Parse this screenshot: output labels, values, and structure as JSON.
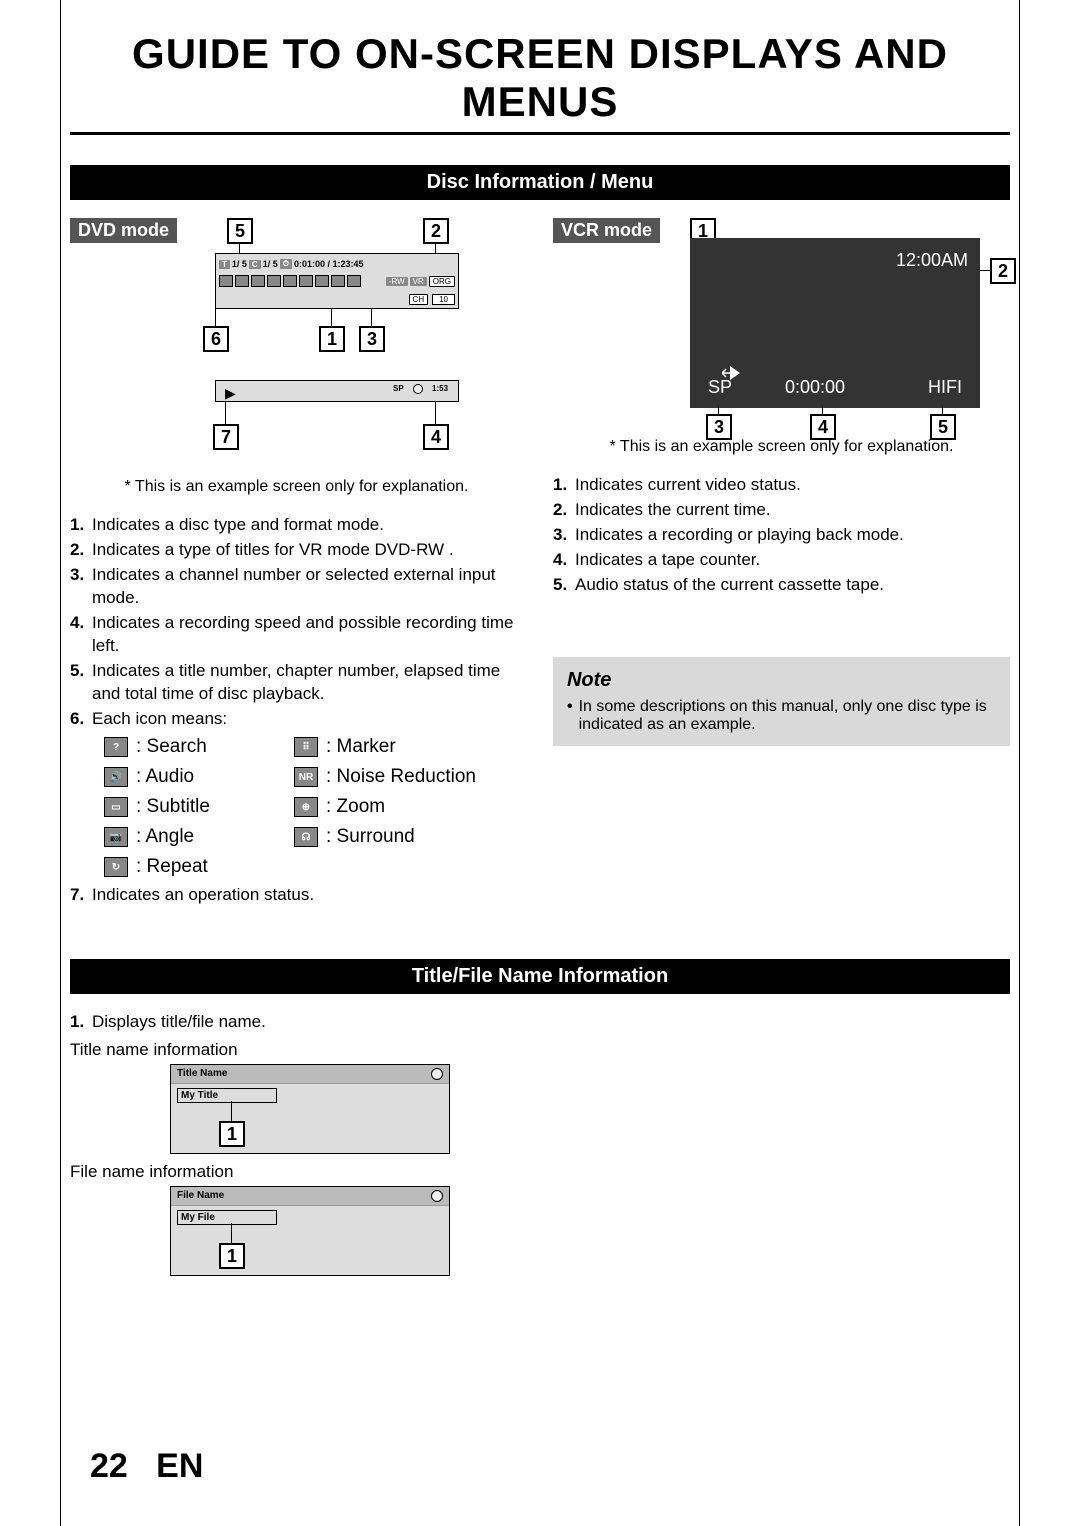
{
  "page": {
    "title": "GUIDE TO ON-SCREEN DISPLAYS AND MENUS",
    "number": "22",
    "lang": "EN"
  },
  "sections": {
    "disc_info": "Disc Information / Menu",
    "title_file": "Title/File Name Information"
  },
  "modes": {
    "dvd": "DVD mode",
    "vcr": "VCR mode"
  },
  "dvd_osd": {
    "t": "T",
    "t_val": "1/   5",
    "c": "C",
    "c_val": "1/   5",
    "time": "0:01:00 / 1:23:45",
    "rw": "-RW",
    "vr": "VR",
    "org": "ORG",
    "ch": "CH",
    "ch_val": "10",
    "sp": "SP",
    "rec_time": "1:53"
  },
  "vcr_osd": {
    "time": "12:00AM",
    "sp": "SP",
    "counter": "0:00:00",
    "hifi": "HIFI"
  },
  "footnote": "* This is an example screen only for explanation.",
  "dvd_list": [
    "Indicates a disc type and format mode.",
    "Indicates a type of titles for VR mode DVD-RW .",
    "Indicates a channel number or selected external input mode.",
    "Indicates a recording speed and possible recording time left.",
    "Indicates a title number, chapter number, elapsed time and total time of disc playback.",
    "Each icon means:",
    "Indicates an operation status."
  ],
  "icon_legend": [
    {
      "sym": "?",
      "label": ": Search"
    },
    {
      "sym": "M",
      "label": ": Marker"
    },
    {
      "sym": "♪",
      "label": ": Audio"
    },
    {
      "sym": "NR",
      "label": ": Noise Reduction"
    },
    {
      "sym": "□",
      "label": ": Subtitle"
    },
    {
      "sym": "⊕",
      "label": ": Zoom"
    },
    {
      "sym": "A",
      "label": ": Angle"
    },
    {
      "sym": "S",
      "label": ": Surround"
    },
    {
      "sym": "↻",
      "label": ": Repeat"
    }
  ],
  "vcr_list": [
    "Indicates current video status.",
    "Indicates the current time.",
    "Indicates a recording or playing back mode.",
    "Indicates a tape counter.",
    "Audio status of the current cassette tape."
  ],
  "note": {
    "heading": "Note",
    "text": "In some descriptions on this manual, only one disc type is indicated as an example."
  },
  "title_file": {
    "item1": "Displays title/file name.",
    "title_info": "Title name information",
    "file_info": "File name information",
    "title_hdr": "Title Name",
    "title_val": "My Title",
    "file_hdr": "File Name",
    "file_val": "My File"
  }
}
